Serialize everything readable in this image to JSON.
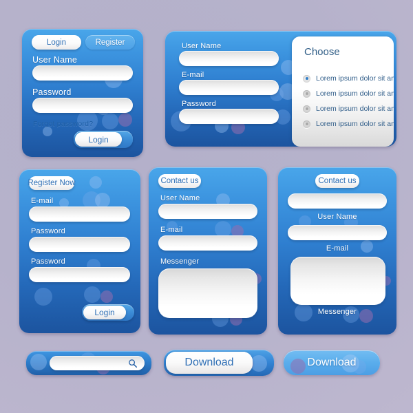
{
  "theme": {
    "background": "#b5b1ca",
    "panel_blue_top": "#49a6ea",
    "panel_blue_bottom": "#1c549f",
    "accent_text_blue": "#2f6fb5",
    "field_white": "#ffffff",
    "bokeh_purple": "#9a6eaf"
  },
  "login_panel": {
    "tabs": [
      {
        "label": "Login",
        "state": "active"
      },
      {
        "label": "Register",
        "state": "inactive"
      }
    ],
    "fields": [
      {
        "label": "User Name",
        "value": "",
        "placeholder": ""
      },
      {
        "label": "Password",
        "value": "",
        "placeholder": ""
      }
    ],
    "forgot_link": "Forgot password?",
    "submit_label": "Login"
  },
  "choose_panel": {
    "fields": [
      {
        "label": "User Name",
        "value": "",
        "placeholder": ""
      },
      {
        "label": "E-mail",
        "value": "",
        "placeholder": ""
      },
      {
        "label": "Password",
        "value": "",
        "placeholder": ""
      }
    ],
    "choose_title": "Choose",
    "options": [
      {
        "label": "Lorem ipsum dolor sit amet",
        "selected": true
      },
      {
        "label": "Lorem ipsum dolor sit amet",
        "selected": false
      },
      {
        "label": "Lorem ipsum dolor sit amet",
        "selected": false
      },
      {
        "label": "Lorem ipsum dolor sit amet",
        "selected": false
      }
    ]
  },
  "register_panel": {
    "tab_label": "Register Now",
    "fields": [
      {
        "label": "E-mail",
        "value": "",
        "placeholder": ""
      },
      {
        "label": "Password",
        "value": "",
        "placeholder": ""
      },
      {
        "label": "Password",
        "value": "",
        "placeholder": ""
      }
    ],
    "submit_label": "Login"
  },
  "contact_panel_labels_above": {
    "tab_label": "Contact us",
    "fields": [
      {
        "label": "User Name",
        "value": "",
        "placeholder": ""
      },
      {
        "label": "E-mail",
        "value": "",
        "placeholder": ""
      }
    ],
    "messenger_label": "Messenger",
    "messenger_value": ""
  },
  "contact_panel_labels_below": {
    "tab_label": "Contact us",
    "fields": [
      {
        "label": "User Name",
        "value": "",
        "placeholder": ""
      },
      {
        "label": "E-mail",
        "value": "",
        "placeholder": ""
      }
    ],
    "messenger_label": "Messenger",
    "messenger_value": ""
  },
  "search_bar": {
    "value": "",
    "placeholder": "",
    "icon": "search-icon"
  },
  "download_button_primary": {
    "label": "Download"
  },
  "download_button_secondary": {
    "label": "Download"
  }
}
